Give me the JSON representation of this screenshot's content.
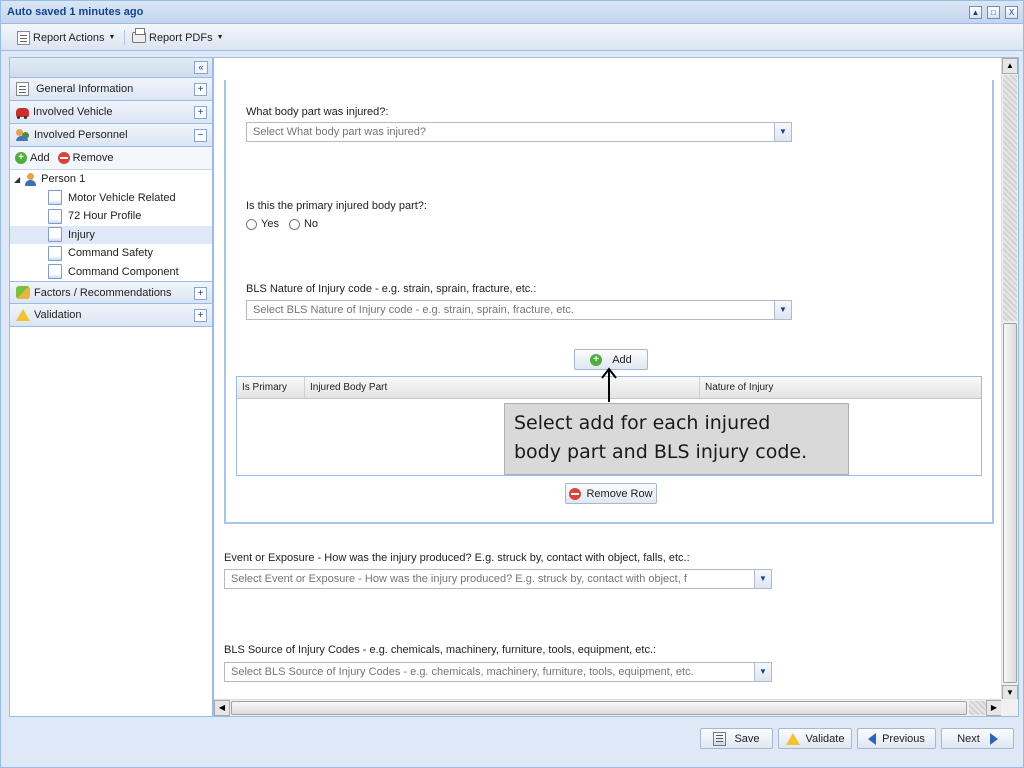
{
  "window": {
    "title": "Auto saved 1 minutes ago",
    "controls": {
      "restore": "▲",
      "maximize": "□",
      "close": "X"
    }
  },
  "toolbar": {
    "report_actions": "Report Actions",
    "report_pdfs": "Report PDFs"
  },
  "sidebar": {
    "collapse_symbol": "«",
    "sections": {
      "general_information": "General Information",
      "involved_vehicle": "Involved Vehicle",
      "involved_personnel": "Involved Personnel",
      "factors": "Factors / Recommendations",
      "validation": "Validation"
    },
    "expand_symbol": "+",
    "collapse_section_symbol": "−",
    "personnel_toolbar": {
      "add": "Add",
      "remove": "Remove"
    },
    "tree": {
      "person": "Person 1",
      "children": [
        "Motor Vehicle Related",
        "72 Hour Profile",
        "Injury",
        "Command Safety",
        "Command Component"
      ],
      "selected": "Injury"
    }
  },
  "form": {
    "body_part": {
      "label": "What body part was injured?:",
      "placeholder": "Select What body part was injured?"
    },
    "primary": {
      "label": "Is this the primary injured body part?:",
      "yes": "Yes",
      "no": "No"
    },
    "nature": {
      "label": "BLS Nature of Injury code - e.g. strain, sprain, fracture, etc.:",
      "placeholder": "Select BLS Nature of Injury code - e.g. strain, sprain, fracture, etc."
    },
    "add_button": "Add",
    "grid": {
      "columns": [
        "Is Primary",
        "Injured Body Part",
        "Nature of Injury"
      ]
    },
    "remove_row_button": "Remove Row",
    "event": {
      "label": "Event or Exposure - How was the injury produced? E.g. struck by, contact with object, falls, etc.:",
      "placeholder": "Select Event or Exposure - How was the injury produced? E.g. struck by, contact with object, f"
    },
    "source": {
      "label": "BLS Source of Injury Codes - e.g. chemicals, machinery, furniture, tools, equipment, etc.:",
      "placeholder": "Select BLS Source of Injury Codes - e.g. chemicals, machinery, furniture, tools, equipment, etc."
    }
  },
  "callout": {
    "line1": "Select add for each injured",
    "line2": "body part and BLS injury code."
  },
  "footer": {
    "save": "Save",
    "validate": "Validate",
    "previous": "Previous",
    "next": "Next"
  }
}
